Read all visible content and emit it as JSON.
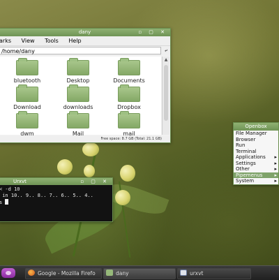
{
  "file_manager": {
    "title": "dany",
    "controls": "▫ ▢ ✕",
    "menu": [
      "arks",
      "View",
      "Tools",
      "Help"
    ],
    "location": "/home/dany",
    "files": [
      "bluetooth",
      "Desktop",
      "Documents",
      "Download",
      "downloads",
      "Dropbox",
      "dwm",
      "Mail",
      "mail"
    ],
    "status": "Free space: 8.7 GB (Total: 21.1 GB)"
  },
  "terminal": {
    "title": "Urxvt",
    "controls": "▫ ▢ ✕",
    "lines": [
      "< -d 10",
      " in 10.. 9.. 8.. 7.. 6.. 5.. 4..",
      "s "
    ]
  },
  "openbox_menu": {
    "header": "Openbox",
    "items": [
      {
        "label": "File Manager",
        "submenu": ""
      },
      {
        "label": "Browser",
        "submenu": ""
      },
      {
        "label": "Run",
        "submenu": ""
      },
      {
        "label": "Terminal",
        "submenu": ""
      },
      {
        "label": "Applications",
        "submenu": "▸"
      },
      {
        "label": "Settings",
        "submenu": "▸"
      },
      {
        "label": "Other",
        "submenu": "▸"
      },
      {
        "label": "Pipemenus",
        "submenu": "▸"
      },
      {
        "label": "System",
        "submenu": "▸"
      }
    ],
    "selected_index": 7
  },
  "taskbar": {
    "tasks": [
      {
        "label": "Google - Mozilla Firefo",
        "icon": "firefox-icon"
      },
      {
        "label": "dany",
        "icon": "folder-icon"
      },
      {
        "label": "urxvt",
        "icon": "terminal-icon"
      }
    ]
  },
  "colors": {
    "accent": "#7fa36a",
    "titlebar": "#6f9455"
  }
}
